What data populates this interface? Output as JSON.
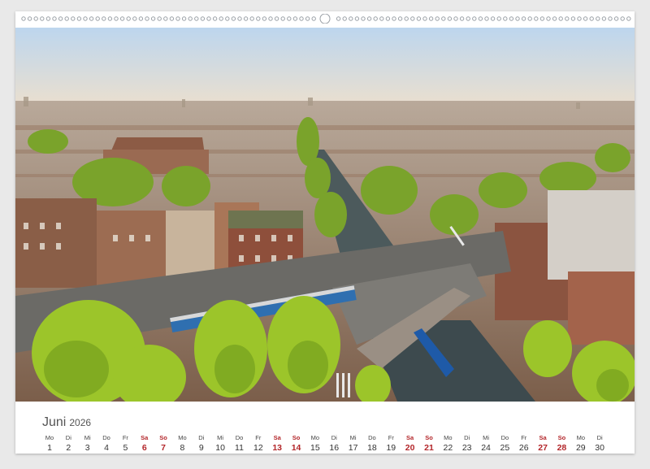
{
  "calendar": {
    "month": "Juni",
    "year": "2026",
    "days": [
      {
        "abbr": "Mo",
        "num": "1",
        "weekend": false
      },
      {
        "abbr": "Di",
        "num": "2",
        "weekend": false
      },
      {
        "abbr": "Mi",
        "num": "3",
        "weekend": false
      },
      {
        "abbr": "Do",
        "num": "4",
        "weekend": false
      },
      {
        "abbr": "Fr",
        "num": "5",
        "weekend": false
      },
      {
        "abbr": "Sa",
        "num": "6",
        "weekend": true
      },
      {
        "abbr": "So",
        "num": "7",
        "weekend": true
      },
      {
        "abbr": "Mo",
        "num": "8",
        "weekend": false
      },
      {
        "abbr": "Di",
        "num": "9",
        "weekend": false
      },
      {
        "abbr": "Mi",
        "num": "10",
        "weekend": false
      },
      {
        "abbr": "Do",
        "num": "11",
        "weekend": false
      },
      {
        "abbr": "Fr",
        "num": "12",
        "weekend": false
      },
      {
        "abbr": "Sa",
        "num": "13",
        "weekend": true
      },
      {
        "abbr": "So",
        "num": "14",
        "weekend": true
      },
      {
        "abbr": "Mo",
        "num": "15",
        "weekend": false
      },
      {
        "abbr": "Di",
        "num": "16",
        "weekend": false
      },
      {
        "abbr": "Mi",
        "num": "17",
        "weekend": false
      },
      {
        "abbr": "Do",
        "num": "18",
        "weekend": false
      },
      {
        "abbr": "Fr",
        "num": "19",
        "weekend": false
      },
      {
        "abbr": "Sa",
        "num": "20",
        "weekend": true
      },
      {
        "abbr": "So",
        "num": "21",
        "weekend": true
      },
      {
        "abbr": "Mo",
        "num": "22",
        "weekend": false
      },
      {
        "abbr": "Di",
        "num": "23",
        "weekend": false
      },
      {
        "abbr": "Mi",
        "num": "24",
        "weekend": false
      },
      {
        "abbr": "Do",
        "num": "25",
        "weekend": false
      },
      {
        "abbr": "Fr",
        "num": "26",
        "weekend": false
      },
      {
        "abbr": "Sa",
        "num": "27",
        "weekend": true
      },
      {
        "abbr": "So",
        "num": "28",
        "weekend": true
      },
      {
        "abbr": "Mo",
        "num": "29",
        "weekend": false
      },
      {
        "abbr": "Di",
        "num": "30",
        "weekend": false
      }
    ]
  },
  "colors": {
    "weekend": "#b3262a",
    "sky": "#cfe0f0",
    "canal": "#3d4a4e",
    "foliage": "#8fbf2a"
  }
}
